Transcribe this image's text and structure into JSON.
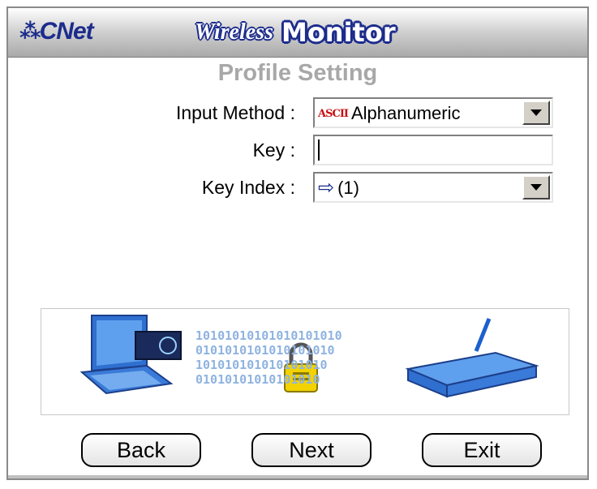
{
  "window": {
    "brand_mark": "ℹ︎",
    "brand_name": "CNet",
    "title_part1": "Wireless",
    "title_part2": "Monitor"
  },
  "section_title": "Profile Setting",
  "form": {
    "input_method": {
      "label": "Input Method :",
      "value": "Alphanumeric",
      "icon_text": "ASCII"
    },
    "key": {
      "label": "Key :",
      "value": ""
    },
    "key_index": {
      "label": "Key Index :",
      "value": "(1)"
    }
  },
  "buttons": {
    "back": "Back",
    "next": "Next",
    "exit": "Exit"
  },
  "banner": {
    "binary_lines": [
      "10101010101010101010",
      "0101010101010101010",
      "101010101010101010",
      "01010101010101010"
    ]
  },
  "colors": {
    "brand_blue": "#1c2c8c",
    "section_title_gray": "#a8a8a8",
    "binary_blue": "#8fb3e0"
  }
}
